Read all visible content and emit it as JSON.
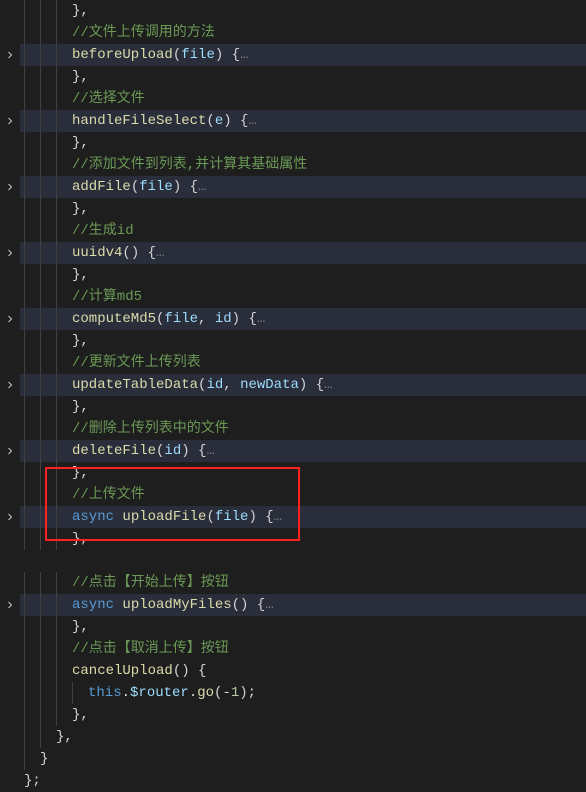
{
  "comments": {
    "c1": "//文件上传调用的方法",
    "c2": "//选择文件",
    "c3": "//添加文件到列表,并计算其基础属性",
    "c4": "//生成id",
    "c5": "//计算md5",
    "c6": "//更新文件上传列表",
    "c7": "//删除上传列表中的文件",
    "c8": "//上传文件",
    "c9": "//点击【开始上传】按钮",
    "c10": "//点击【取消上传】按钮"
  },
  "funcs": {
    "f1": {
      "name": "beforeUpload",
      "params": [
        "file"
      ]
    },
    "f2": {
      "name": "handleFileSelect",
      "params": [
        "e"
      ]
    },
    "f3": {
      "name": "addFile",
      "params": [
        "file"
      ]
    },
    "f4": {
      "name": "uuidv4",
      "params": []
    },
    "f5": {
      "name": "computeMd5",
      "params": [
        "file",
        "id"
      ]
    },
    "f6": {
      "name": "updateTableData",
      "params": [
        "id",
        "newData"
      ]
    },
    "f7": {
      "name": "deleteFile",
      "params": [
        "id"
      ]
    },
    "f8": {
      "name": "uploadFile",
      "params": [
        "file"
      ],
      "async": true
    },
    "f9": {
      "name": "uploadMyFiles",
      "params": [],
      "async": true
    },
    "f10": {
      "name": "cancelUpload",
      "params": []
    }
  },
  "body": {
    "thisKw": "this",
    "router": "$router",
    "goFn": "go",
    "goArg": "-1"
  },
  "glyphs": {
    "ellipsis": "…",
    "async": "async"
  }
}
